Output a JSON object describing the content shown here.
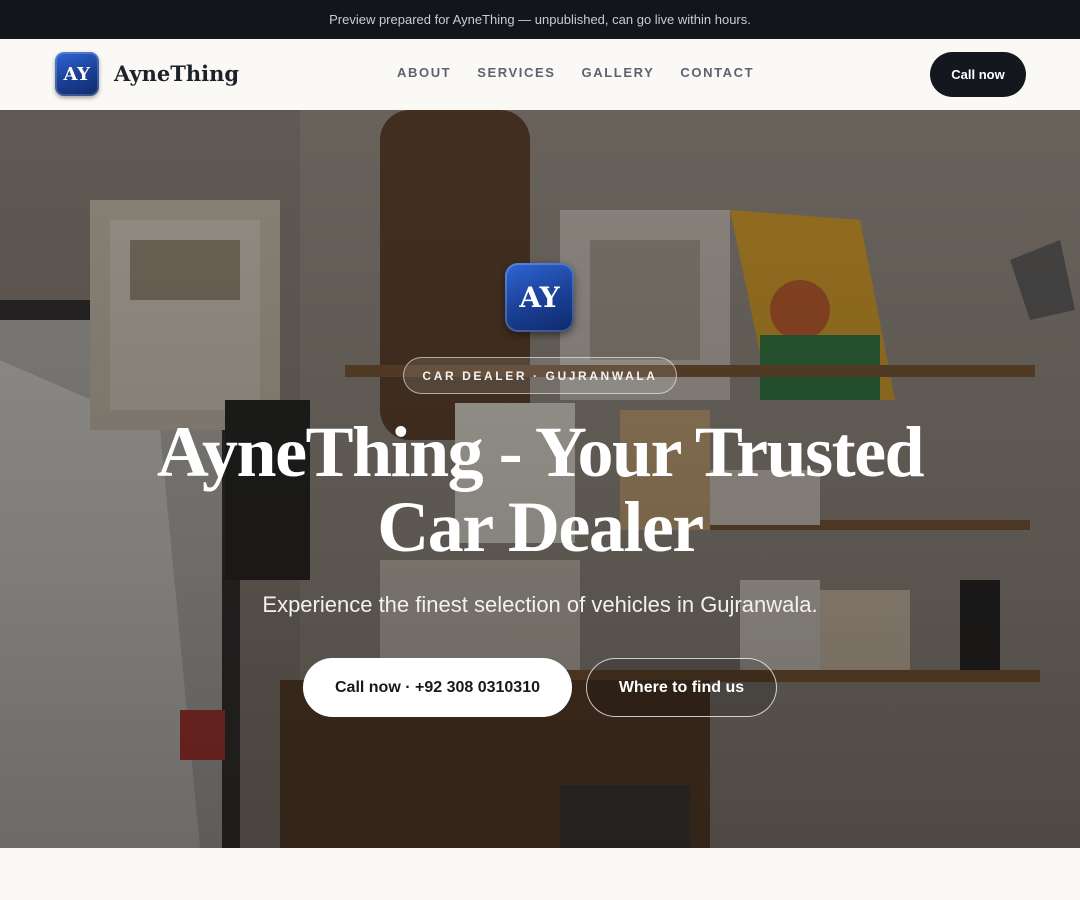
{
  "announcement": "Preview prepared for AyneThing — unpublished, can go live within hours.",
  "header": {
    "logo_initials": "AY",
    "brand_name": "AyneThing",
    "nav": [
      "ABOUT",
      "SERVICES",
      "GALLERY",
      "CONTACT"
    ],
    "cta_label": "Call now"
  },
  "hero": {
    "logo_initials": "AY",
    "eyebrow": "CAR DEALER · GUJRANWALA",
    "headline_line1": "AyneThing - Your Trusted",
    "headline_line2": "Car Dealer",
    "subheadline": "Experience the finest selection of vehicles in Gujranwala.",
    "primary_button": "Call now · +92 308 0310310",
    "secondary_button": "Where to find us",
    "background_image": "interior shop shelves photo"
  },
  "colors": {
    "topbar_bg": "#12151c",
    "brand_blue": "#1a3f94",
    "cta_dark": "#14171d",
    "page_bg": "#faf9f6"
  }
}
